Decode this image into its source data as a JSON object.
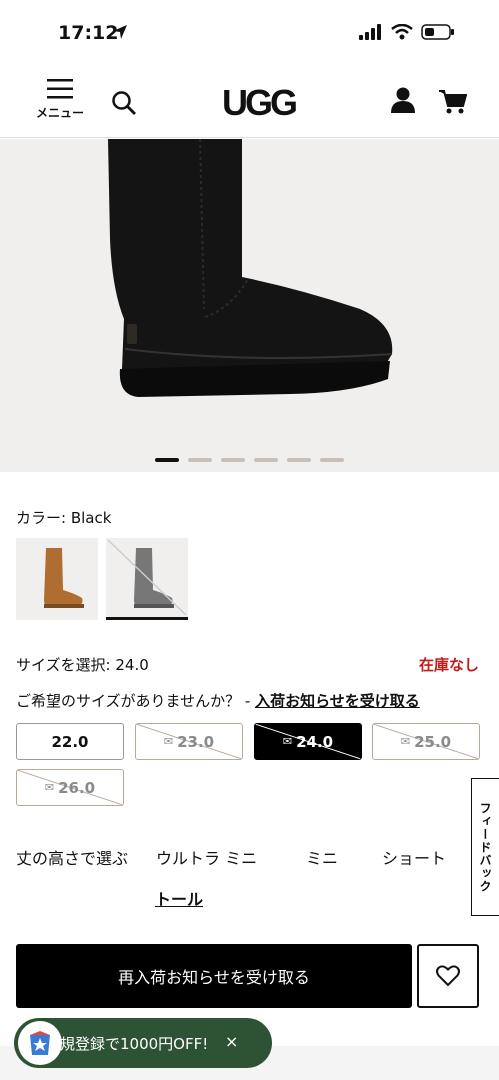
{
  "status_bar": {
    "time": "17:12"
  },
  "header": {
    "menu_label": "メニュー",
    "logo": "UGG"
  },
  "carousel": {
    "slides": 6,
    "active_index": 0
  },
  "product": {
    "color_label": "カラー: Black",
    "size_label": "サイズを選択: 24.0",
    "stock_status": "在庫なし",
    "notify_prefix": "ご希望のサイズがありませんか？ - ",
    "notify_link": "入荷お知らせを受け取る"
  },
  "sizes": [
    {
      "label": "22.0",
      "available": true,
      "selected": false
    },
    {
      "label": "23.0",
      "available": false,
      "selected": false
    },
    {
      "label": "24.0",
      "available": false,
      "selected": true
    },
    {
      "label": "25.0",
      "available": false,
      "selected": false
    },
    {
      "label": "26.0",
      "available": false,
      "selected": false
    }
  ],
  "heights": {
    "label": "丈の高さで選ぶ",
    "options": [
      "ウルトラ ミニ",
      "ミニ",
      "ショート",
      "トール"
    ],
    "selected": "トール"
  },
  "feedback": "フィードバック",
  "cta_label": "再入荷お知らせを受け取る",
  "promo": {
    "text": "規登録で1000円OFF!",
    "close": "×"
  },
  "colors": {
    "primary": "#000000",
    "oos_red": "#c41a1a",
    "promo_green": "#2e5234",
    "hero_bg": "#f0efed"
  }
}
